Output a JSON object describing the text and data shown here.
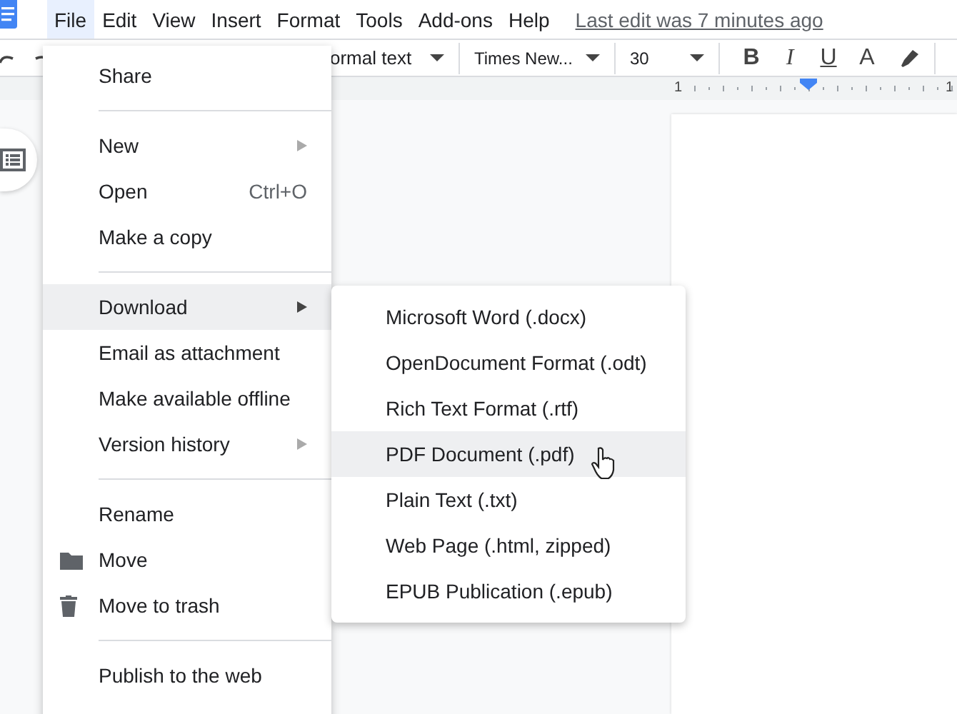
{
  "menu_bar": [
    {
      "label": "File",
      "selected": true
    },
    {
      "label": "Edit",
      "selected": false
    },
    {
      "label": "View",
      "selected": false
    },
    {
      "label": "Insert",
      "selected": false
    },
    {
      "label": "Format",
      "selected": false
    },
    {
      "label": "Tools",
      "selected": false
    },
    {
      "label": "Add-ons",
      "selected": false
    },
    {
      "label": "Help",
      "selected": false
    }
  ],
  "last_edit": "Last edit was 7 minutes ago",
  "toolbar": {
    "style": "ormal text",
    "font": "Times New...",
    "size": "30",
    "format_buttons": [
      "B",
      "I",
      "U",
      "A"
    ]
  },
  "ruler": {
    "labels": [
      "1",
      "1"
    ]
  },
  "file_menu": {
    "items": [
      {
        "kind": "item",
        "label": "Share",
        "selected": false
      },
      {
        "kind": "divider"
      },
      {
        "kind": "item",
        "label": "New",
        "submenu": true,
        "selected": false
      },
      {
        "kind": "item",
        "label": "Open",
        "shortcut": "Ctrl+O",
        "selected": false
      },
      {
        "kind": "item",
        "label": "Make a copy",
        "selected": false
      },
      {
        "kind": "divider"
      },
      {
        "kind": "item",
        "label": "Download",
        "submenu": true,
        "selected": true
      },
      {
        "kind": "item",
        "label": "Email as attachment",
        "selected": false
      },
      {
        "kind": "item",
        "label": "Make available offline",
        "selected": false
      },
      {
        "kind": "item",
        "label": "Version history",
        "submenu": true,
        "selected": false
      },
      {
        "kind": "divider"
      },
      {
        "kind": "item",
        "label": "Rename",
        "selected": false
      },
      {
        "kind": "folder",
        "label": "Move",
        "selected": false
      },
      {
        "kind": "trash",
        "label": "Move to trash",
        "selected": false
      },
      {
        "kind": "divider"
      },
      {
        "kind": "item",
        "label": "Publish to the web",
        "selected": false
      }
    ]
  },
  "download_menu": {
    "items": [
      {
        "label": "Microsoft Word (.docx)",
        "selected": false
      },
      {
        "label": "OpenDocument Format (.odt)",
        "selected": false
      },
      {
        "label": "Rich Text Format (.rtf)",
        "selected": false
      },
      {
        "label": "PDF Document (.pdf)",
        "selected": true,
        "pointer": true
      },
      {
        "label": "Plain Text (.txt)",
        "selected": false
      },
      {
        "label": "Web Page (.html, zipped)",
        "selected": false
      },
      {
        "label": "EPUB Publication (.epub)",
        "selected": false
      }
    ]
  }
}
